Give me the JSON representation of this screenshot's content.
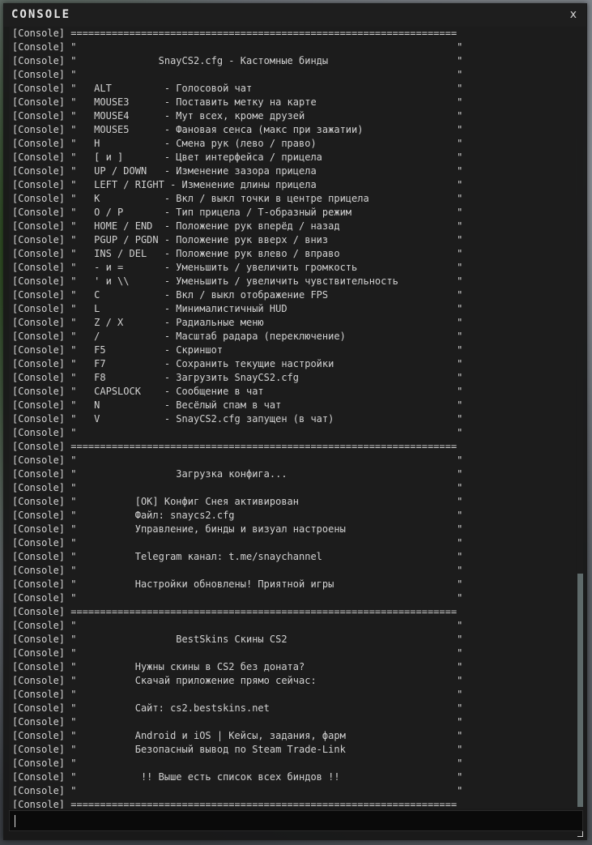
{
  "window": {
    "title": "CONSOLE",
    "close_glyph": "x",
    "accent_color": "#5e6a6a"
  },
  "console": {
    "lines": [
      "[Console] ==================================================================",
      "[Console] \"                                                                 \"",
      "[Console] \"              SnayCS2.cfg - Кастомные бинды                      \"",
      "[Console] \"                                                                 \"",
      "[Console] \"   ALT         - Голосовой чат                                   \"",
      "[Console] \"   MOUSE3      - Поставить метку на карте                        \"",
      "[Console] \"   MOUSE4      - Мут всех, кроме друзей                          \"",
      "[Console] \"   MOUSE5      - Фановая сенса (макс при зажатии)                \"",
      "[Console] \"   H           - Смена рук (лево / право)                        \"",
      "[Console] \"   [ и ]       - Цвет интерфейса / прицела                       \"",
      "[Console] \"   UP / DOWN   - Изменение зазора прицела                        \"",
      "[Console] \"   LEFT / RIGHT - Изменение длины прицела                        \"",
      "[Console] \"   K           - Вкл / выкл точки в центре прицела               \"",
      "[Console] \"   O / P       - Тип прицела / T-образный режим                  \"",
      "[Console] \"   HOME / END  - Положение рук вперёд / назад                    \"",
      "[Console] \"   PGUP / PGDN - Положение рук вверх / вниз                      \"",
      "[Console] \"   INS / DEL   - Положение рук влево / вправо                    \"",
      "[Console] \"   - и =       - Уменьшить / увеличить громкость                 \"",
      "[Console] \"   ' и \\\\      - Уменьшить / увеличить чувствительность          \"",
      "[Console] \"   C           - Вкл / выкл отображение FPS                      \"",
      "[Console] \"   L           - Минималистичный HUD                             \"",
      "[Console] \"   Z / X       - Радиальные меню                                 \"",
      "[Console] \"   /           - Масштаб радара (переключение)                   \"",
      "[Console] \"   F5          - Скриншот                                        \"",
      "[Console] \"   F7          - Сохранить текущие настройки                     \"",
      "[Console] \"   F8          - Загрузить SnayCS2.cfg                           \"",
      "[Console] \"   CAPSLOCK    - Сообщение в чат                                 \"",
      "[Console] \"   N           - Весёлый спам в чат                              \"",
      "[Console] \"   V           - SnayCS2.cfg запущен (в чат)                     \"",
      "[Console] \"                                                                 \"",
      "[Console] ==================================================================",
      "[Console] \"                                                                 \"",
      "[Console] \"                 Загрузка конфига...                             \"",
      "[Console] \"                                                                 \"",
      "[Console] \"          [OK] Конфиг Снея активирован                           \"",
      "[Console] \"          Файл: snaycs2.cfg                                      \"",
      "[Console] \"          Управление, бинды и визуал настроены                   \"",
      "[Console] \"                                                                 \"",
      "[Console] \"          Telegram канал: t.me/snaychannel                       \"",
      "[Console] \"                                                                 \"",
      "[Console] \"          Настройки обновлены! Приятной игры                     \"",
      "[Console] \"                                                                 \"",
      "[Console] ==================================================================",
      "[Console] \"                                                                 \"",
      "[Console] \"                 BestSkins Скины CS2                             \"",
      "[Console] \"                                                                 \"",
      "[Console] \"          Нужны скины в CS2 без доната?                          \"",
      "[Console] \"          Скачай приложение прямо сейчас:                        \"",
      "[Console] \"                                                                 \"",
      "[Console] \"          Сайт: cs2.bestskins.net                                \"",
      "[Console] \"                                                                 \"",
      "[Console] \"          Android и iOS | Кейсы, задания, фарм                   \"",
      "[Console] \"          Безопасный вывод по Steam Trade-Link                   \"",
      "[Console] \"                                                                 \"",
      "[Console] \"           !! Выше есть список всех биндов !!                    \"",
      "[Console] \"                                                                 \"",
      "[Console] =================================================================="
    ]
  },
  "input": {
    "value": "",
    "placeholder": ""
  }
}
